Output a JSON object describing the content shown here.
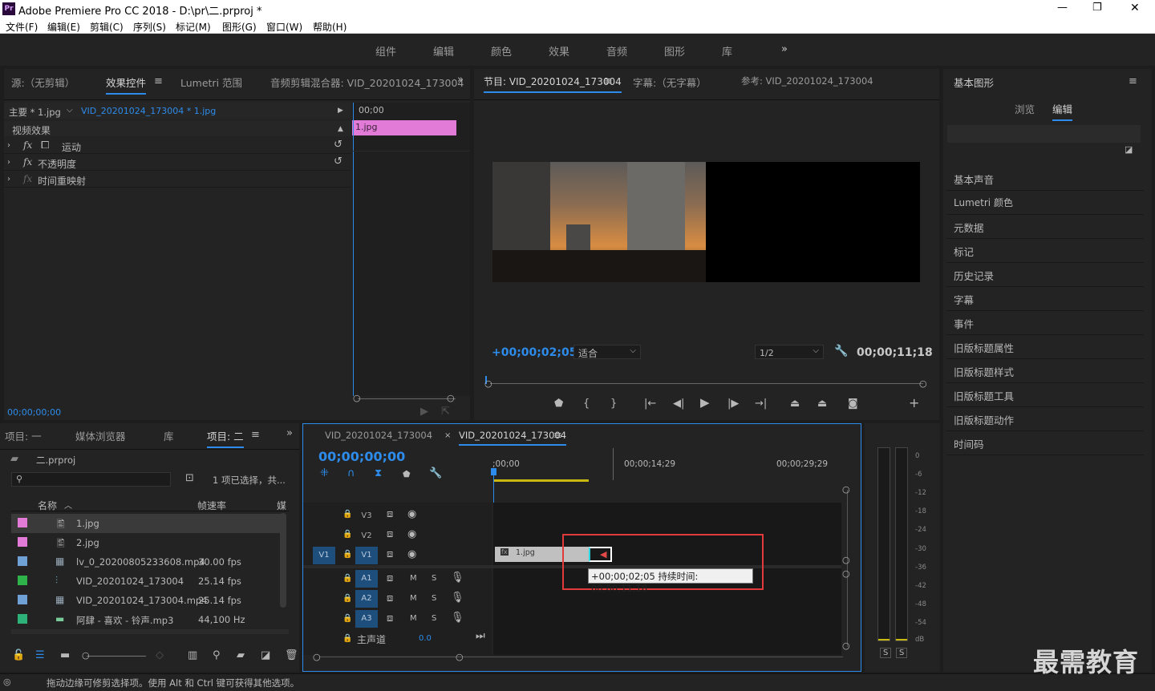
{
  "window": {
    "title": "Adobe Premiere Pro CC 2018 - D:\\pr\\二.prproj *",
    "app_icon": "Pr",
    "min": "—",
    "max": "❐",
    "close": "✕"
  },
  "menu": [
    "文件(F)",
    "编辑(E)",
    "剪辑(C)",
    "序列(S)",
    "标记(M)",
    "图形(G)",
    "窗口(W)",
    "帮助(H)"
  ],
  "workspaces": [
    "组件",
    "编辑",
    "颜色",
    "效果",
    "音频",
    "图形",
    "库",
    "»"
  ],
  "source_panel": {
    "tabs": [
      "源:（无剪辑）",
      "效果控件",
      "Lumetri 范围",
      "音频剪辑混合器: VID_20201024_173004"
    ],
    "master": "主要 * 1.jpg",
    "clip": "VID_20201024_173004 * 1.jpg",
    "time_ruler": "00;00",
    "clip_bar": "1.jpg",
    "section": "视频效果",
    "effects": [
      "运动",
      "不透明度",
      "时间重映射"
    ],
    "timecode": "00;00;00;00"
  },
  "program_panel": {
    "tabs": [
      "节目: VID_20201024_173004",
      "字幕:（无字幕）",
      "参考: VID_20201024_173004"
    ],
    "timecode": "+00;00;02;05",
    "fit": "适合",
    "res": "1/2",
    "duration": "00;00;11;18"
  },
  "project_panel": {
    "tabs": [
      "项目: 一",
      "媒体浏览器",
      "库",
      "项目: 二"
    ],
    "project_name": "二.prproj",
    "selection_info": "1 项已选择，共...",
    "columns": [
      "名称",
      "帧速率",
      "媒"
    ],
    "items": [
      {
        "name": "1.jpg",
        "fps": "",
        "color": "#e27bd8"
      },
      {
        "name": "2.jpg",
        "fps": "",
        "color": "#e27bd8"
      },
      {
        "name": "lv_0_20200805233608.mp4",
        "fps": "30.00 fps",
        "color": "#6fa0d6"
      },
      {
        "name": "VID_20201024_173004",
        "fps": "25.14 fps",
        "color": "#2db34a"
      },
      {
        "name": "VID_20201024_173004.mp4",
        "fps": "25.14 fps",
        "color": "#6fa0d6"
      },
      {
        "name": "阿肆 - 喜欢 - 铃声.mp3",
        "fps": "44,100 Hz",
        "color": "#2db37a"
      }
    ]
  },
  "timeline": {
    "tabs": [
      "VID_20201024_173004",
      "VID_20201024_173004"
    ],
    "timecode": "00;00;00;00",
    "ruler": [
      ";00;00",
      "00;00;14;29",
      "00;00;29;29"
    ],
    "video_tracks": [
      "V3",
      "V2",
      "V1"
    ],
    "audio_tracks": [
      "A1",
      "A2",
      "A3"
    ],
    "source_patch": "V1",
    "master_label": "主声道",
    "master_value": "0.0",
    "clip_label": "1.jpg",
    "tooltip": "+00;00;02;05 持续时间: 00;00;11;18",
    "m": "M",
    "s": "S"
  },
  "meters": {
    "ticks": [
      "0",
      "-6",
      "-12",
      "-18",
      "-24",
      "-30",
      "-36",
      "-42",
      "-48",
      "-54",
      "dB"
    ],
    "solo": [
      "S",
      "S"
    ]
  },
  "essential_graphics": {
    "title": "基本图形",
    "tabs": [
      "浏览",
      "编辑"
    ],
    "panels": [
      "基本声音",
      "Lumetri 颜色",
      "元数据",
      "标记",
      "历史记录",
      "字幕",
      "事件",
      "旧版标题属性",
      "旧版标题样式",
      "旧版标题工具",
      "旧版标题动作",
      "时间码"
    ]
  },
  "status": "拖动边缘可修剪选择项。使用 Alt 和 Ctrl 键可获得其他选项。",
  "watermark": "最需教育"
}
